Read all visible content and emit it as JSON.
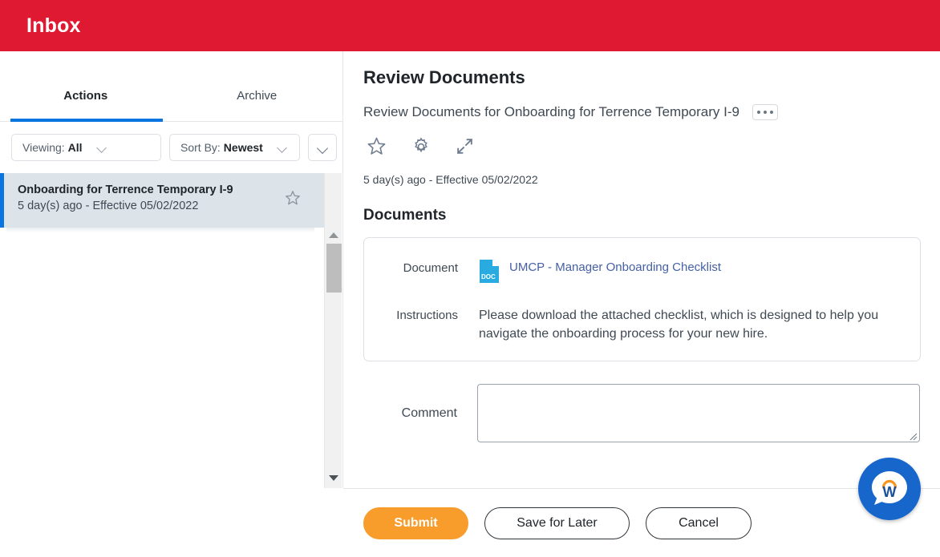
{
  "header": {
    "title": "Inbox",
    "background_color": "#e01933"
  },
  "left_panel": {
    "tabs": [
      {
        "label": "Actions",
        "active": true
      },
      {
        "label": "Archive",
        "active": false
      }
    ],
    "filters": {
      "viewing": {
        "label": "Viewing:",
        "value": "All"
      },
      "sort_by": {
        "label": "Sort By:",
        "value": "Newest"
      },
      "more_label": ""
    },
    "items": [
      {
        "title": "Onboarding for Terrence Temporary I-9",
        "subtitle": "5 day(s) ago - Effective 05/02/2022",
        "selected": true
      }
    ],
    "accent_color": "#0875e1",
    "selected_background": "#dde4e9"
  },
  "task": {
    "title": "Review Documents",
    "subtitle": "Review Documents for Onboarding for Terrence Temporary I-9",
    "meta": "5 day(s) ago -  Effective 05/02/2022",
    "icons": [
      "star-icon",
      "gear-icon",
      "expand-icon",
      "overflow-menu-icon"
    ]
  },
  "documents_section": {
    "heading": "Documents",
    "document": {
      "label": "Document",
      "file_type": "DOC",
      "link_text": "UMCP - Manager Onboarding Checklist",
      "link_color": "#4560a5",
      "icon_color": "#29abe2"
    },
    "instructions": {
      "label": "Instructions",
      "text": "Please download the attached checklist, which is designed to help you navigate the onboarding process for your new hire."
    }
  },
  "comment": {
    "label": "Comment",
    "value": "",
    "placeholder": ""
  },
  "footer": {
    "submit_label": "Submit",
    "save_label": "Save for Later",
    "cancel_label": "Cancel",
    "submit_color": "#f89c2c"
  },
  "assistant": {
    "name": "Workday Assistant",
    "letter": "W",
    "background_color": "#1666cc",
    "arc_color": "#f7941e"
  }
}
